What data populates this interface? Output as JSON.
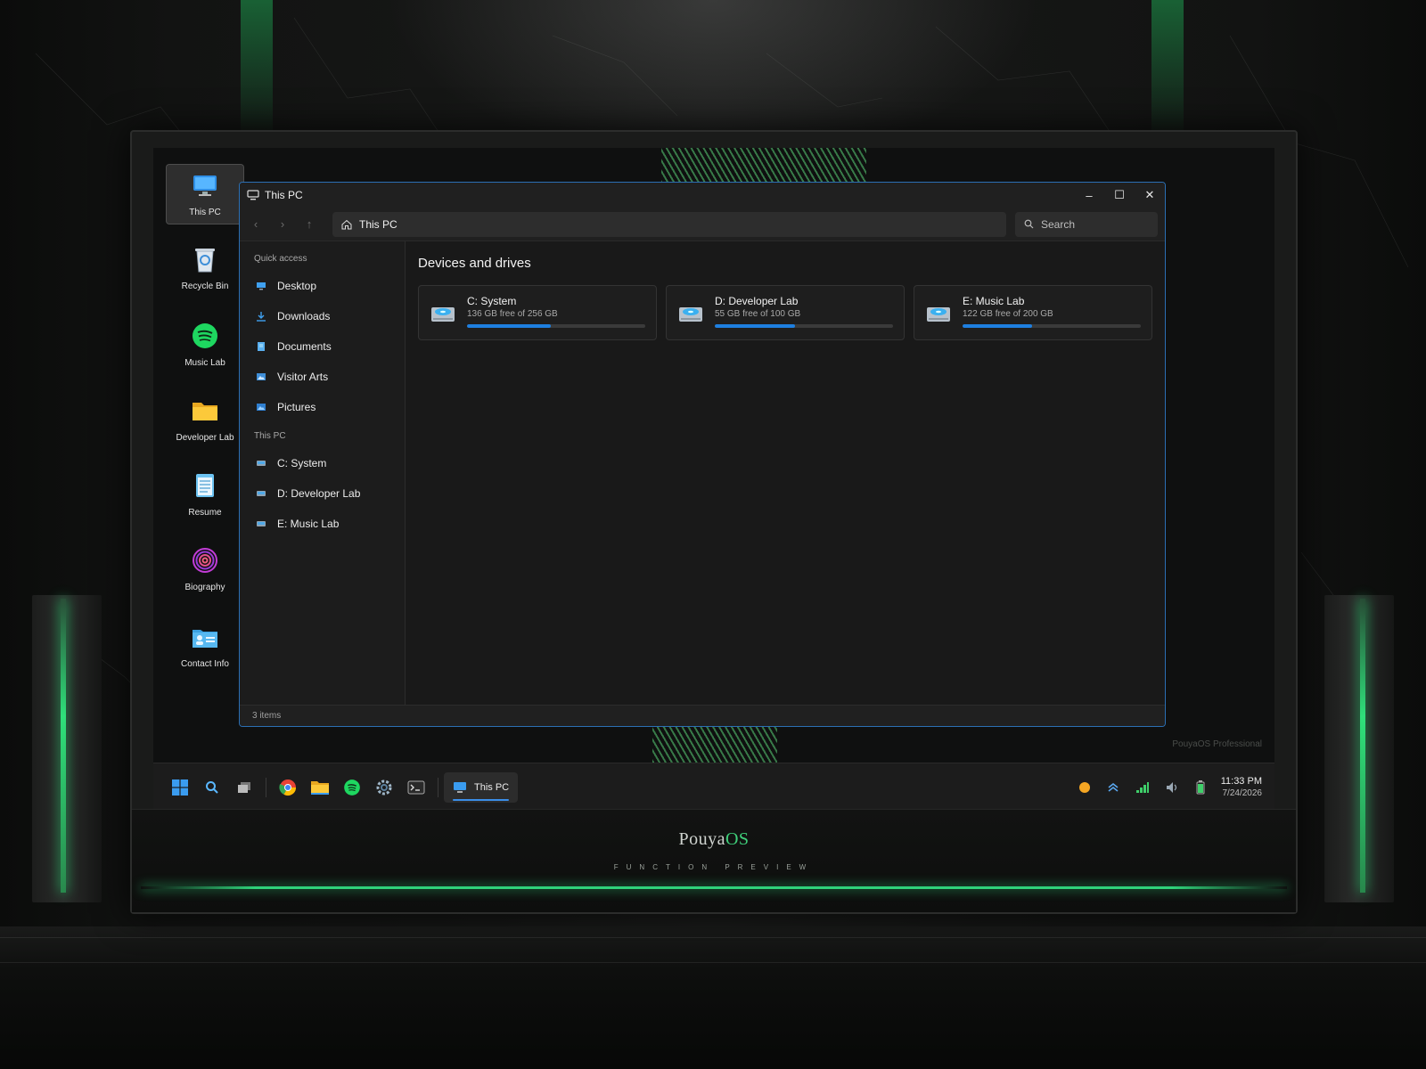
{
  "desktop": {
    "icons": [
      {
        "label": "This PC",
        "icon": "monitor-icon"
      },
      {
        "label": "Recycle Bin",
        "icon": "recycle-bin-icon"
      },
      {
        "label": "Music Lab",
        "icon": "spotify-icon"
      },
      {
        "label": "Developer Lab",
        "icon": "folder-icon"
      },
      {
        "label": "Resume",
        "icon": "notepad-icon"
      },
      {
        "label": "Biography",
        "icon": "fingerprint-icon"
      },
      {
        "label": "Contact Info",
        "icon": "contact-card-icon"
      }
    ],
    "watermark": "PouyaOS Professional"
  },
  "window": {
    "title": "This PC",
    "address": "This PC",
    "search_placeholder": "Search",
    "controls": {
      "minimize": "–",
      "maximize": "☐",
      "close": "✕"
    },
    "nav": {
      "back": "‹",
      "forward": "›",
      "up": "↑"
    },
    "accent": "#2b6fb4"
  },
  "sidebar": {
    "quick_access_header": "Quick access",
    "quick_access": [
      {
        "label": "Desktop",
        "icon": "desktop-icon"
      },
      {
        "label": "Downloads",
        "icon": "download-icon"
      },
      {
        "label": "Documents",
        "icon": "document-icon"
      },
      {
        "label": "Visitor Arts",
        "icon": "image-folder-icon"
      },
      {
        "label": "Pictures",
        "icon": "picture-icon"
      }
    ],
    "this_pc_header": "This PC",
    "drives": [
      {
        "label": "C: System",
        "icon": "drive-icon"
      },
      {
        "label": "D: Developer Lab",
        "icon": "drive-icon"
      },
      {
        "label": "E: Music Lab",
        "icon": "drive-icon"
      }
    ]
  },
  "content": {
    "section_title": "Devices and drives",
    "drives": [
      {
        "name": "C: System",
        "free_text": "136 GB free of 256 GB",
        "used_fraction": 0.47
      },
      {
        "name": "D: Developer Lab",
        "free_text": "55 GB free of 100 GB",
        "used_fraction": 0.45
      },
      {
        "name": "E: Music Lab",
        "free_text": "122 GB free of 200 GB",
        "used_fraction": 0.39
      }
    ],
    "bar_color": "#1e7fe0"
  },
  "status": {
    "items_text": "3 items"
  },
  "taskbar": {
    "pinned": [
      "start-icon",
      "search-icon",
      "task-view-icon",
      "chrome-icon",
      "file-explorer-icon",
      "spotify-icon",
      "settings-icon",
      "terminal-icon"
    ],
    "active_app_label": "This PC",
    "tray": [
      "notification-dot-icon",
      "chevron-up-icon",
      "network-icon",
      "volume-icon",
      "battery-icon"
    ],
    "time": "11:33 PM",
    "date": "7/24/2026"
  },
  "brand": {
    "name_prefix": "Pouya",
    "name_suffix": "OS",
    "tagline": "FUNCTION PREVIEW",
    "accent": "#3fcf7a"
  }
}
